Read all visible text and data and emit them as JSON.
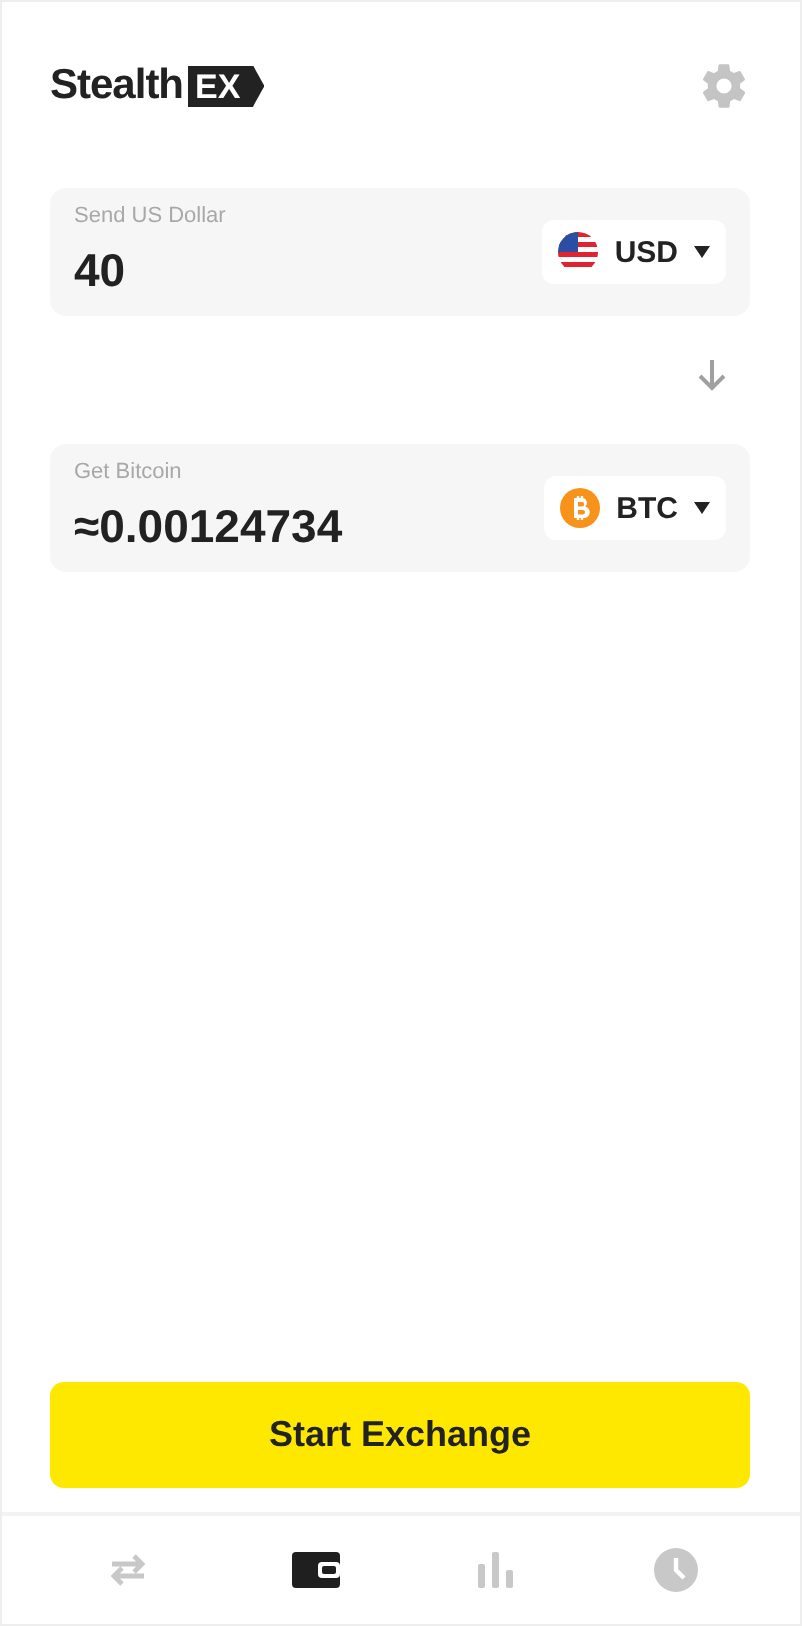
{
  "logo": {
    "word": "Stealth",
    "tag": "EX"
  },
  "send": {
    "label": "Send US Dollar",
    "value": "40",
    "currency": {
      "code": "USD",
      "kind": "usd"
    }
  },
  "get": {
    "label": "Get Bitcoin",
    "value": "≈0.00124734",
    "currency": {
      "code": "BTC",
      "kind": "btc"
    }
  },
  "action": {
    "label": "Start Exchange"
  },
  "nav": [
    {
      "kind": "swap",
      "selected": false
    },
    {
      "kind": "wallet",
      "selected": true
    },
    {
      "kind": "chart",
      "selected": false
    },
    {
      "kind": "history",
      "selected": false
    }
  ]
}
